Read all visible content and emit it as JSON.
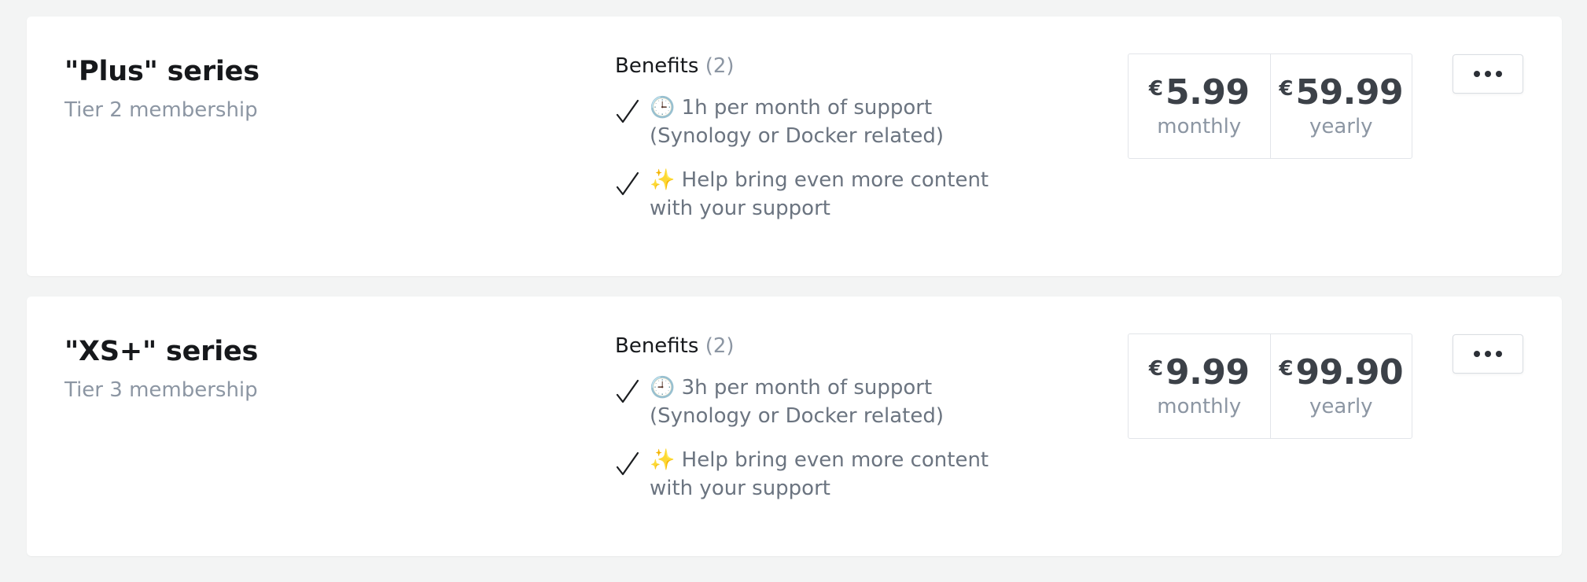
{
  "tiers": [
    {
      "name": "\"Plus\" series",
      "subtitle": "Tier 2 membership",
      "benefits_label": "Benefits",
      "benefits_count": "(2)",
      "benefits": [
        {
          "emoji": "🕒",
          "text": "1h per month of support\n(Synology or Docker related)"
        },
        {
          "emoji": "✨",
          "text": "Help bring even more content\nwith your support"
        }
      ],
      "prices": [
        {
          "currency": "€",
          "amount": "5.99",
          "period": "monthly"
        },
        {
          "currency": "€",
          "amount": "59.99",
          "period": "yearly"
        }
      ]
    },
    {
      "name": "\"XS+\" series",
      "subtitle": "Tier 3 membership",
      "benefits_label": "Benefits",
      "benefits_count": "(2)",
      "benefits": [
        {
          "emoji": "🕘",
          "text": "3h per month of support\n(Synology or Docker related)"
        },
        {
          "emoji": "✨",
          "text": "Help bring even more content\nwith your support"
        }
      ],
      "prices": [
        {
          "currency": "€",
          "amount": "9.99",
          "period": "monthly"
        },
        {
          "currency": "€",
          "amount": "99.90",
          "period": "yearly"
        }
      ]
    }
  ],
  "icons": {
    "check": "check-icon",
    "more": "more-horizontal-icon"
  },
  "colors": {
    "page_background": "#f3f4f4",
    "card_background": "#ffffff",
    "title": "#16181b",
    "muted": "#8c96a3",
    "body_text": "#6b7480",
    "price": "#3c4148"
  }
}
